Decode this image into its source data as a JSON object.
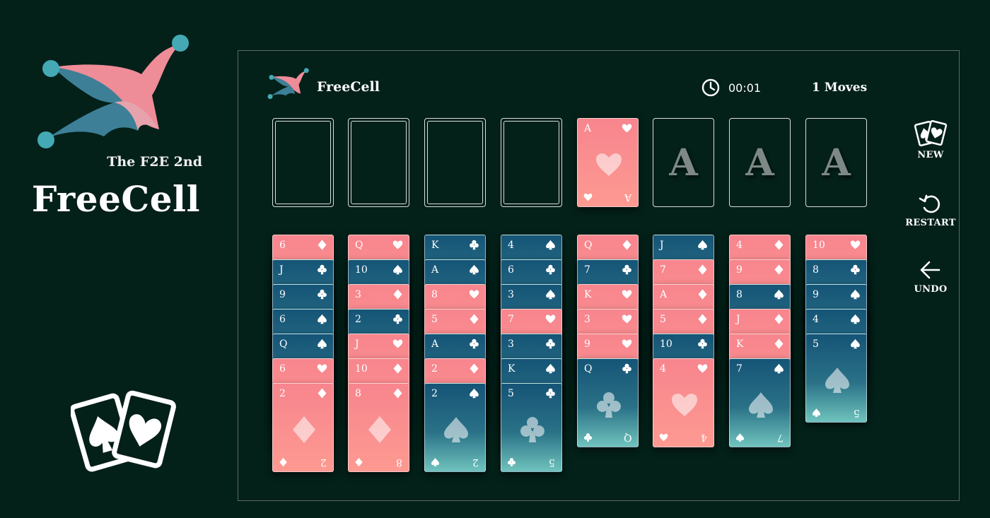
{
  "promo": {
    "subtitle": "The F2E 2nd",
    "title": "FreeCell"
  },
  "header": {
    "title": "FreeCell",
    "timer": "00:01",
    "moves": "1 Moves"
  },
  "colors": {
    "background": "#032019",
    "pink": "#f7858e",
    "teal": "#2a7187",
    "jester_pink": "#ee8c98",
    "jester_teal": "#3c7f96",
    "jester_ball": "#44a9b5"
  },
  "free_cells": [
    {
      "state": "empty"
    },
    {
      "state": "empty"
    },
    {
      "state": "empty"
    },
    {
      "state": "empty"
    }
  ],
  "foundations": [
    {
      "state": "card",
      "rank": "A",
      "suit": "heart"
    },
    {
      "state": "empty",
      "placeholder": "A"
    },
    {
      "state": "empty",
      "placeholder": "A"
    },
    {
      "state": "empty",
      "placeholder": "A"
    }
  ],
  "tableau": [
    [
      {
        "rank": "6",
        "suit": "diamond"
      },
      {
        "rank": "J",
        "suit": "club"
      },
      {
        "rank": "9",
        "suit": "club"
      },
      {
        "rank": "6",
        "suit": "spade"
      },
      {
        "rank": "Q",
        "suit": "spade"
      },
      {
        "rank": "6",
        "suit": "heart"
      },
      {
        "rank": "2",
        "suit": "diamond"
      }
    ],
    [
      {
        "rank": "Q",
        "suit": "heart"
      },
      {
        "rank": "10",
        "suit": "spade"
      },
      {
        "rank": "3",
        "suit": "diamond"
      },
      {
        "rank": "2",
        "suit": "club"
      },
      {
        "rank": "J",
        "suit": "heart"
      },
      {
        "rank": "10",
        "suit": "diamond"
      },
      {
        "rank": "8",
        "suit": "diamond"
      }
    ],
    [
      {
        "rank": "K",
        "suit": "club"
      },
      {
        "rank": "A",
        "suit": "spade"
      },
      {
        "rank": "8",
        "suit": "heart"
      },
      {
        "rank": "5",
        "suit": "diamond"
      },
      {
        "rank": "A",
        "suit": "club"
      },
      {
        "rank": "2",
        "suit": "diamond"
      },
      {
        "rank": "2",
        "suit": "spade"
      }
    ],
    [
      {
        "rank": "4",
        "suit": "spade"
      },
      {
        "rank": "6",
        "suit": "club"
      },
      {
        "rank": "3",
        "suit": "spade"
      },
      {
        "rank": "7",
        "suit": "heart"
      },
      {
        "rank": "3",
        "suit": "club"
      },
      {
        "rank": "K",
        "suit": "spade"
      },
      {
        "rank": "5",
        "suit": "club"
      }
    ],
    [
      {
        "rank": "Q",
        "suit": "diamond"
      },
      {
        "rank": "7",
        "suit": "club"
      },
      {
        "rank": "K",
        "suit": "heart"
      },
      {
        "rank": "3",
        "suit": "heart"
      },
      {
        "rank": "9",
        "suit": "heart"
      },
      {
        "rank": "Q",
        "suit": "club"
      }
    ],
    [
      {
        "rank": "J",
        "suit": "spade"
      },
      {
        "rank": "7",
        "suit": "diamond"
      },
      {
        "rank": "A",
        "suit": "diamond"
      },
      {
        "rank": "5",
        "suit": "diamond"
      },
      {
        "rank": "10",
        "suit": "club"
      },
      {
        "rank": "4",
        "suit": "heart"
      }
    ],
    [
      {
        "rank": "4",
        "suit": "diamond"
      },
      {
        "rank": "9",
        "suit": "diamond"
      },
      {
        "rank": "8",
        "suit": "spade"
      },
      {
        "rank": "J",
        "suit": "diamond"
      },
      {
        "rank": "K",
        "suit": "diamond"
      },
      {
        "rank": "7",
        "suit": "spade"
      }
    ],
    [
      {
        "rank": "10",
        "suit": "heart"
      },
      {
        "rank": "8",
        "suit": "club"
      },
      {
        "rank": "9",
        "suit": "spade"
      },
      {
        "rank": "4",
        "suit": "spade"
      },
      {
        "rank": "5",
        "suit": "spade"
      }
    ]
  ],
  "sidebar": {
    "buttons": [
      {
        "label": "NEW",
        "icon": "cards-icon"
      },
      {
        "label": "RESTART",
        "icon": "restart-icon"
      },
      {
        "label": "UNDO",
        "icon": "arrow-left-icon"
      }
    ]
  }
}
